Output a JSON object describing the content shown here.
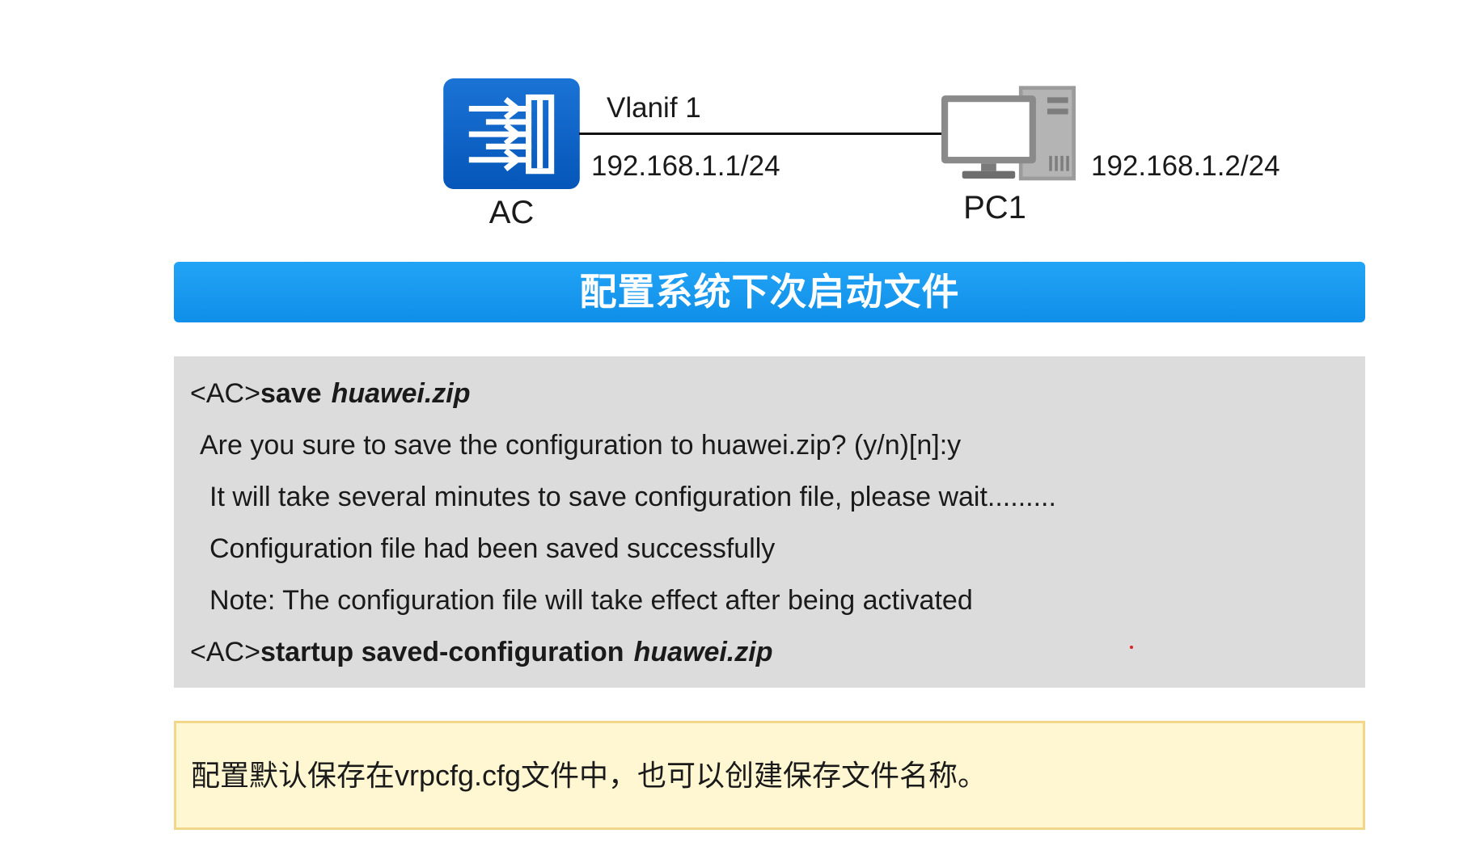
{
  "topology": {
    "ac": {
      "label": "AC",
      "icon": "ac-controller-icon"
    },
    "pc": {
      "label": "PC1",
      "icon": "pc-icon"
    },
    "link": {
      "interface": "Vlanif 1",
      "ac_ip": "192.168.1.1/24",
      "pc_ip": "192.168.1.2/24"
    }
  },
  "banner": {
    "title": "配置系统下次启动文件"
  },
  "terminal": {
    "lines": [
      {
        "prompt": "<AC>",
        "command": "save",
        "argument": "huawei.zip"
      },
      {
        "text": "Are you sure to save the configuration to huawei.zip? (y/n)[n]:y"
      },
      {
        "text": "It will take several minutes to save configuration file, please wait........."
      },
      {
        "text": "Configuration file had been saved successfully"
      },
      {
        "text": "Note: The configuration file will take effect after being activated"
      },
      {
        "prompt": "<AC>",
        "command": "startup saved-configuration",
        "argument": "huawei.zip"
      }
    ]
  },
  "note": {
    "text": "配置默认保存在vrpcfg.cfg文件中，也可以创建保存文件名称。"
  },
  "colors": {
    "ac_icon": "#0b62c8",
    "banner": "#1a9bf0",
    "terminal_bg": "#dcdcdc",
    "note_bg": "#fff6d2",
    "note_border": "#f2d78a",
    "pointer_dot": "#e02020"
  }
}
